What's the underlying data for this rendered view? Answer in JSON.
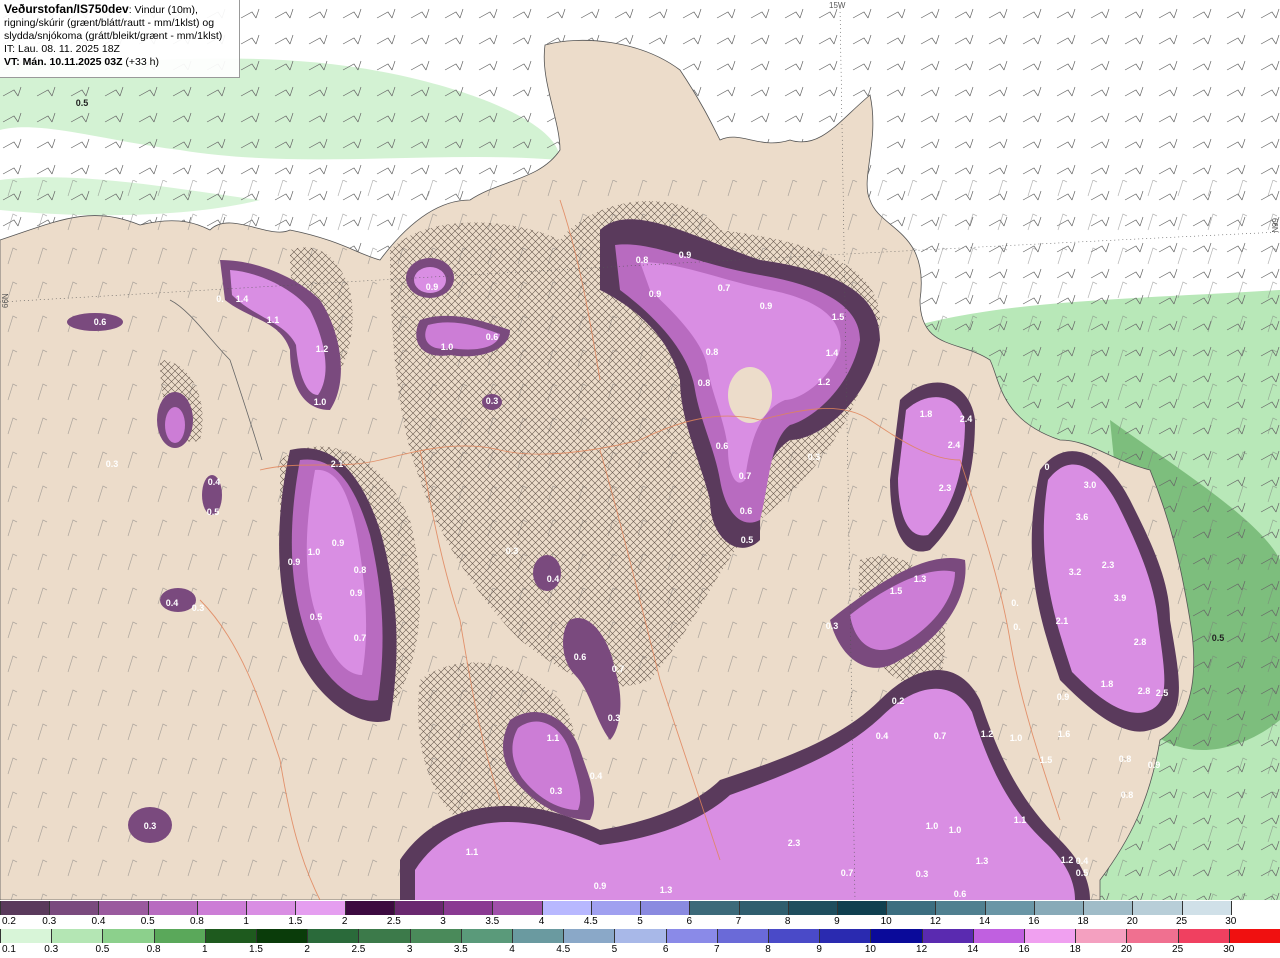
{
  "header": {
    "title": "Veðurstofan/IS750dev",
    "desc_1": ": Vindur (10m),",
    "desc_2": "rigning/skúrir (grænt/blátt/rautt - mm/1klst) og",
    "desc_3": "slydda/snjókoma (grátt/bleikt/grænt - mm/1klst)",
    "it_line": "IT: Lau. 08. 11. 2025 18Z",
    "vt_label": "VT: Mán. 10.11.2025 03Z",
    "vt_extra": " (+33 h)"
  },
  "grid_labels": {
    "lon_15w": "15W",
    "lat_66n_left": "66N",
    "lat_66n_right": "66N"
  },
  "precip_labels": [
    {
      "text": "0.5",
      "cls": "sea"
    },
    {
      "text": "0.6"
    },
    {
      "text": "1.4"
    },
    {
      "text": "1.1"
    },
    {
      "text": "0."
    },
    {
      "text": "1.2"
    },
    {
      "text": "1.0"
    },
    {
      "text": "0.9"
    },
    {
      "text": "1.0"
    },
    {
      "text": "0.6"
    },
    {
      "text": "0.3"
    },
    {
      "text": "0.8"
    },
    {
      "text": "0.9"
    },
    {
      "text": "0.9"
    },
    {
      "text": "0.7"
    },
    {
      "text": "0.9"
    },
    {
      "text": "1.5"
    },
    {
      "text": "1.4"
    },
    {
      "text": "1.2"
    },
    {
      "text": "0.8"
    },
    {
      "text": "0.8"
    },
    {
      "text": "0.6"
    },
    {
      "text": "0.7"
    },
    {
      "text": "0.6"
    },
    {
      "text": "0.5"
    },
    {
      "text": "0.3"
    },
    {
      "text": "2.1"
    },
    {
      "text": "1.0"
    },
    {
      "text": "0.9"
    },
    {
      "text": "0.9"
    },
    {
      "text": "0.8"
    },
    {
      "text": "0.9"
    },
    {
      "text": "0.5"
    },
    {
      "text": "0.7"
    },
    {
      "text": "0.4"
    },
    {
      "text": "0.5"
    },
    {
      "text": "0.4"
    },
    {
      "text": "0.3"
    },
    {
      "text": "0.3"
    },
    {
      "text": "0.4"
    },
    {
      "text": "0.6"
    },
    {
      "text": "0.7"
    },
    {
      "text": "0.3"
    },
    {
      "text": "1.1"
    },
    {
      "text": "0.4"
    },
    {
      "text": "0.3"
    },
    {
      "text": "0.3"
    },
    {
      "text": "1.8"
    },
    {
      "text": "2.4"
    },
    {
      "text": "2.4"
    },
    {
      "text": "2.3"
    },
    {
      "text": "1.3"
    },
    {
      "text": "1.5"
    },
    {
      "text": "0.3"
    },
    {
      "text": "3.0"
    },
    {
      "text": "3.6"
    },
    {
      "text": "3.2"
    },
    {
      "text": "2.3"
    },
    {
      "text": "3.9"
    },
    {
      "text": "2.1"
    },
    {
      "text": "2.8"
    },
    {
      "text": "1.8"
    },
    {
      "text": "2.8"
    },
    {
      "text": "2.5"
    },
    {
      "text": "0.5",
      "cls": "sea"
    },
    {
      "text": "0.9"
    },
    {
      "text": "1.6"
    },
    {
      "text": "1.5"
    },
    {
      "text": "0.8"
    },
    {
      "text": "0.9"
    },
    {
      "text": "0.8"
    },
    {
      "text": "0.2"
    },
    {
      "text": "0.4"
    },
    {
      "text": "0.7"
    },
    {
      "text": "1.2"
    },
    {
      "text": "1.0"
    },
    {
      "text": "1.1"
    },
    {
      "text": "1.0"
    },
    {
      "text": "1.0"
    },
    {
      "text": "1.3"
    },
    {
      "text": "1.1"
    },
    {
      "text": "1.2"
    },
    {
      "text": "2.3"
    },
    {
      "text": "0.9"
    },
    {
      "text": "1.3"
    },
    {
      "text": "0.7"
    },
    {
      "text": "0.3"
    },
    {
      "text": "0.6"
    },
    {
      "text": "0.4"
    },
    {
      "text": "0.5"
    },
    {
      "text": "0"
    },
    {
      "text": "0."
    },
    {
      "text": "0."
    },
    {
      "text": "0.3"
    }
  ],
  "snow_scale": {
    "ticks": [
      "0.2",
      "0.3",
      "0.4",
      "0.5",
      "0.8",
      "1",
      "1.5",
      "2",
      "2.5",
      "3",
      "3.5",
      "4",
      "4.5",
      "5",
      "6",
      "7",
      "8",
      "9",
      "10",
      "12",
      "14",
      "16",
      "18",
      "20",
      "25",
      "30"
    ],
    "colors": [
      "#5a3a5c",
      "#7a4a7e",
      "#9a5a9e",
      "#b86bc0",
      "#cc7dd6",
      "#d98ee3",
      "#e59ef0",
      "#3c0a40",
      "#6a2870",
      "#8a3a92",
      "#a050aa",
      "#b8b8ff",
      "#a0a0f0",
      "#8a8ae0",
      "#3c6a7a",
      "#2f5e6e",
      "#1f4e5e",
      "#104050",
      "#3c6e80",
      "#508090",
      "#6a96a6",
      "#88aab8",
      "#a0bcc8",
      "#b8ced8",
      "#d0e0e8",
      "#ffffff"
    ]
  },
  "rain_scale": {
    "ticks": [
      "0.1",
      "0.3",
      "0.5",
      "0.8",
      "1",
      "1.5",
      "2",
      "2.5",
      "3",
      "3.5",
      "4",
      "4.5",
      "5",
      "6",
      "7",
      "8",
      "9",
      "10",
      "12",
      "14",
      "16",
      "18",
      "20",
      "25",
      "30"
    ],
    "colors": [
      "#d8f5d8",
      "#b4e6b4",
      "#8cd08c",
      "#5aa85a",
      "#1e5a1e",
      "#0a3c0a",
      "#2a6a3a",
      "#3c7a4a",
      "#4a8a5a",
      "#5a9a7a",
      "#6a9aa0",
      "#8aa8c8",
      "#a8b8e8",
      "#8a8ae8",
      "#6a6ad8",
      "#4a4ac8",
      "#2a2ab0",
      "#0a0a9a",
      "#5a2ab0",
      "#c060e0",
      "#f0a0f0",
      "#f4a0c0",
      "#f07090",
      "#f04060",
      "#f01010"
    ]
  }
}
